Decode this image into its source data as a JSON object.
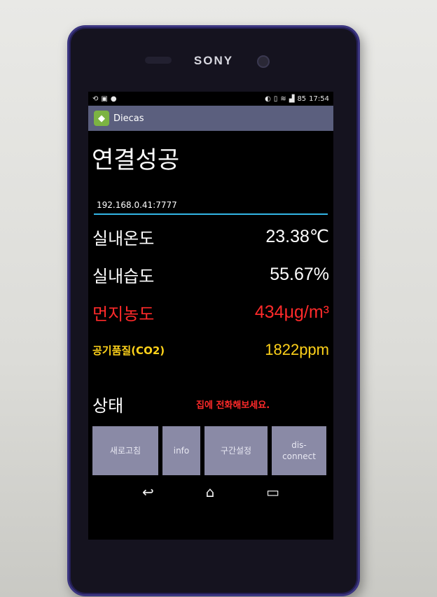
{
  "device": {
    "brand": "SONY"
  },
  "status_bar": {
    "time": "17:54",
    "battery": "85"
  },
  "action_bar": {
    "title": "Diecas"
  },
  "connection": {
    "status_text": "연결성공",
    "address_value": "192.168.0.41:7777"
  },
  "readings": [
    {
      "label": "실내온도",
      "value": "23.38℃",
      "color": "#ffffff"
    },
    {
      "label": "실내습도",
      "value": "55.67%",
      "color": "#ffffff"
    },
    {
      "label": "먼지농도",
      "value": "434μg/m³",
      "color": "#ff2a2a"
    },
    {
      "label": "공기품질(CO2)",
      "value": "1822ppm",
      "color": "#ffd21a"
    }
  ],
  "state": {
    "label": "상태",
    "message": "집에 전화해보세요."
  },
  "buttons": {
    "refresh": "새로고침",
    "info": "info",
    "range": "구간설정",
    "disconnect": "dis-connect"
  },
  "icons": {
    "back": "back-icon",
    "home": "home-icon",
    "recents": "recents-icon"
  }
}
